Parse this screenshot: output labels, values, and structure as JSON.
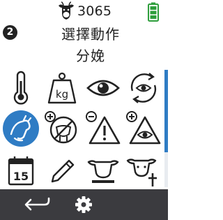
{
  "status": {
    "animal_count": "3065",
    "icons": [
      "cow-head-icon",
      "battery-icon"
    ],
    "battery_color": "#2e9e3c"
  },
  "header": {
    "step_number": "2",
    "title": "選擇動作",
    "subtitle": "分娩"
  },
  "grid": {
    "selected_index": 4,
    "selected_color": "#2f7cc4",
    "items": [
      {
        "icon": "thermometer-icon"
      },
      {
        "icon": "weight-kg-icon",
        "text": "kg"
      },
      {
        "icon": "eye-icon"
      },
      {
        "icon": "recheck-eye-icon"
      },
      {
        "icon": "calving-icon"
      },
      {
        "icon": "no-milk-icon"
      },
      {
        "icon": "warning-minus-icon"
      },
      {
        "icon": "warning-eye-plus-icon"
      },
      {
        "icon": "calendar-icon",
        "text": "15"
      },
      {
        "icon": "pencil-icon"
      },
      {
        "icon": "cull-cow-icon"
      },
      {
        "icon": "dead-cow-icon"
      }
    ]
  },
  "bottom_bar": {
    "icons": [
      "back-arrow-icon",
      "gear-icon"
    ]
  }
}
